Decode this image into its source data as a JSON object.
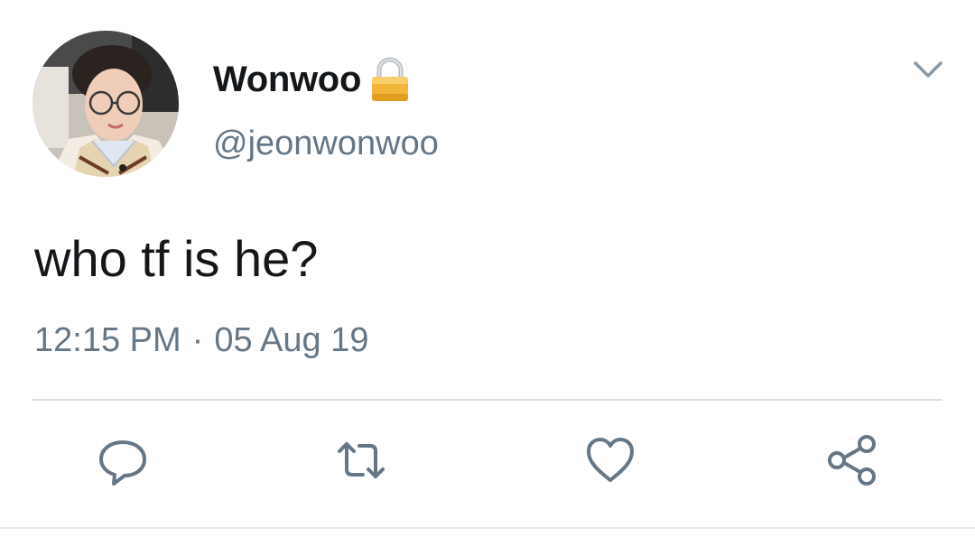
{
  "tweet": {
    "author": {
      "display_name": "Wonwoo",
      "handle": "@jeonwonwoo",
      "protected_icon": "lock-icon",
      "avatar": "profile-photo"
    },
    "text": "who tf is he?",
    "time": "12:15 PM",
    "separator": "·",
    "date": "05 Aug 19",
    "menu_icon": "chevron-down-icon",
    "actions": [
      {
        "name": "reply",
        "icon": "reply-icon"
      },
      {
        "name": "retweet",
        "icon": "retweet-icon"
      },
      {
        "name": "like",
        "icon": "heart-icon"
      },
      {
        "name": "share",
        "icon": "share-icon"
      }
    ]
  },
  "colors": {
    "text_primary": "#14171a",
    "text_secondary": "#657786",
    "icon": "#657786",
    "divider": "#d9dee2",
    "lock_gold": "#f2b63d"
  }
}
